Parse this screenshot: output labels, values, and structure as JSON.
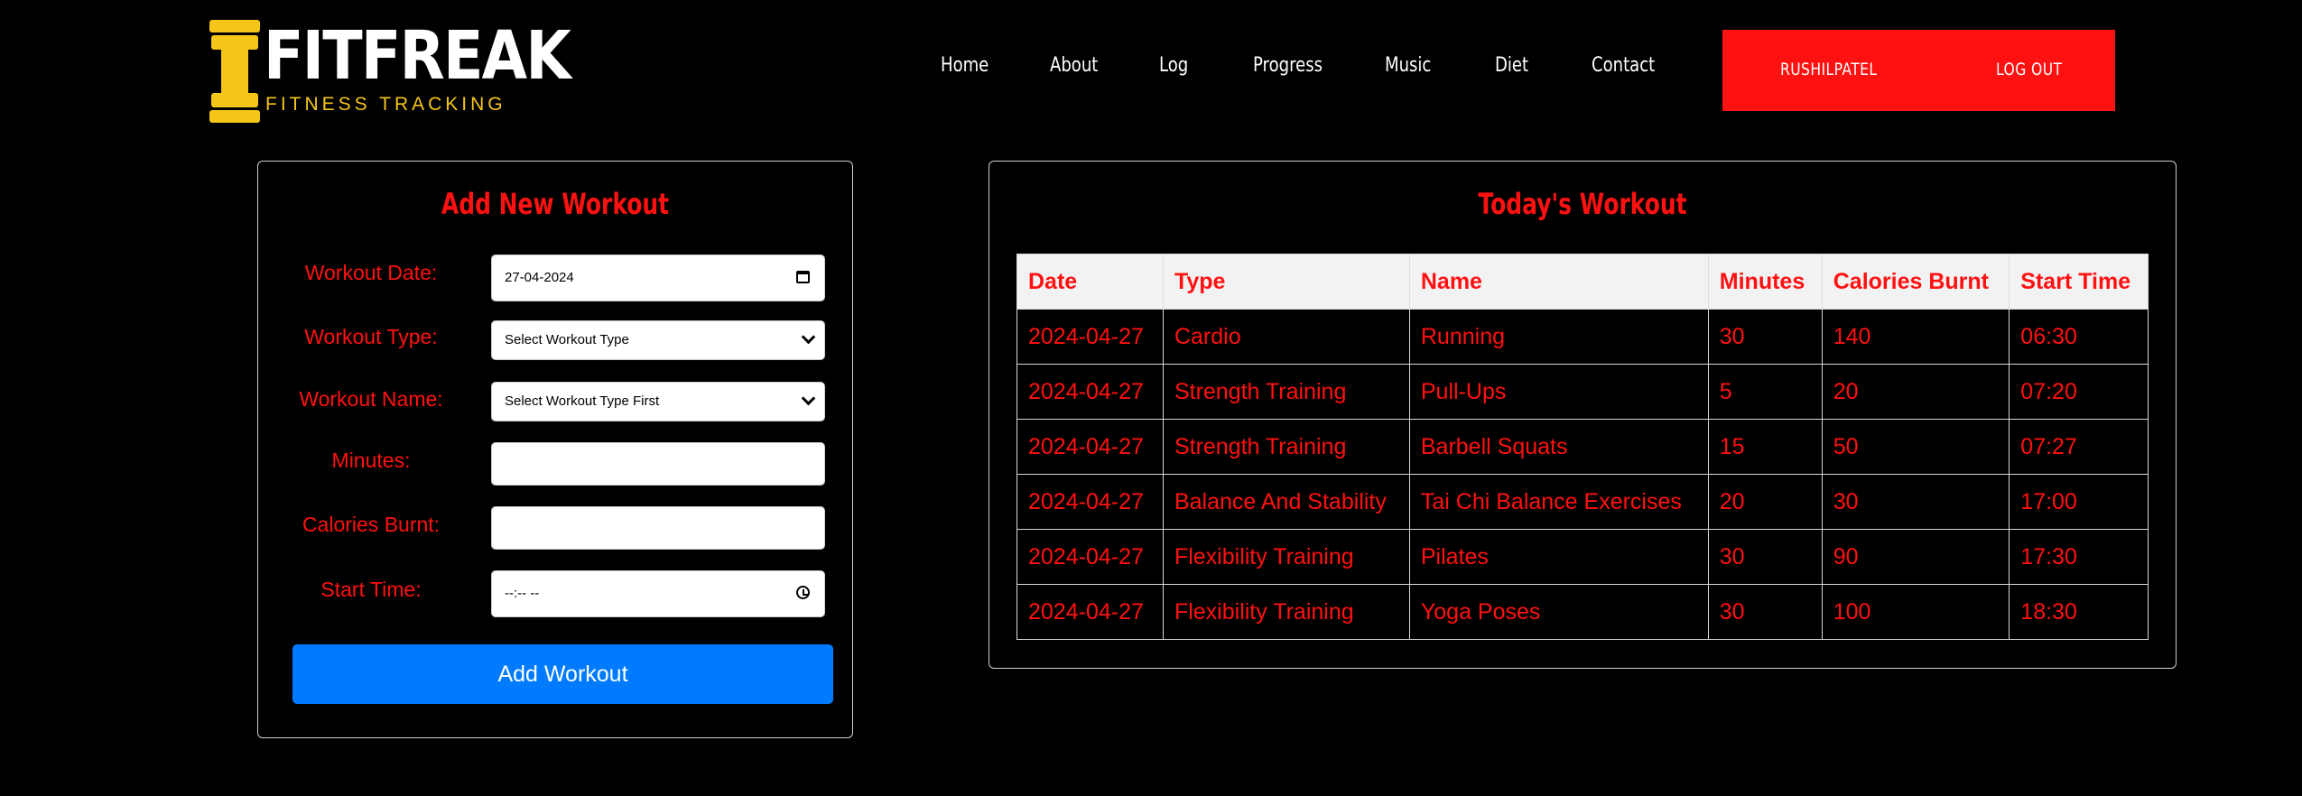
{
  "header": {
    "brand": "FITFREAK",
    "tagline": "FITNESS TRACKING",
    "colors": {
      "accent": "#ff1111",
      "brand": "#f5c518",
      "primary_button": "#007bff"
    },
    "nav": [
      {
        "label": "Home"
      },
      {
        "label": "About"
      },
      {
        "label": "Log"
      },
      {
        "label": "Progress"
      },
      {
        "label": "Music"
      },
      {
        "label": "Diet"
      },
      {
        "label": "Contact"
      }
    ],
    "user": {
      "username": "RUSHILPATEL",
      "logout_label": "LOG OUT"
    }
  },
  "form": {
    "title": "Add New Workout",
    "date_label": "Workout Date:",
    "date_value": "27-04-2024",
    "type_label": "Workout Type:",
    "type_value": "Select Workout Type",
    "name_label": "Workout Name:",
    "name_value": "Select Workout Type First",
    "minutes_label": "Minutes:",
    "minutes_value": "",
    "calories_label": "Calories Burnt:",
    "calories_value": "",
    "time_label": "Start Time:",
    "time_value": "--:-- --",
    "submit_label": "Add Workout"
  },
  "today": {
    "title": "Today's Workout",
    "columns": [
      "Date",
      "Type",
      "Name",
      "Minutes",
      "Calories Burnt",
      "Start Time"
    ],
    "rows": [
      [
        "2024-04-27",
        "Cardio",
        "Running",
        "30",
        "140",
        "06:30"
      ],
      [
        "2024-04-27",
        "Strength Training",
        "Pull-Ups",
        "5",
        "20",
        "07:20"
      ],
      [
        "2024-04-27",
        "Strength Training",
        "Barbell Squats",
        "15",
        "50",
        "07:27"
      ],
      [
        "2024-04-27",
        "Balance And Stability",
        "Tai Chi Balance Exercises",
        "20",
        "30",
        "17:00"
      ],
      [
        "2024-04-27",
        "Flexibility Training",
        "Pilates",
        "30",
        "90",
        "17:30"
      ],
      [
        "2024-04-27",
        "Flexibility Training",
        "Yoga Poses",
        "30",
        "100",
        "18:30"
      ]
    ]
  }
}
